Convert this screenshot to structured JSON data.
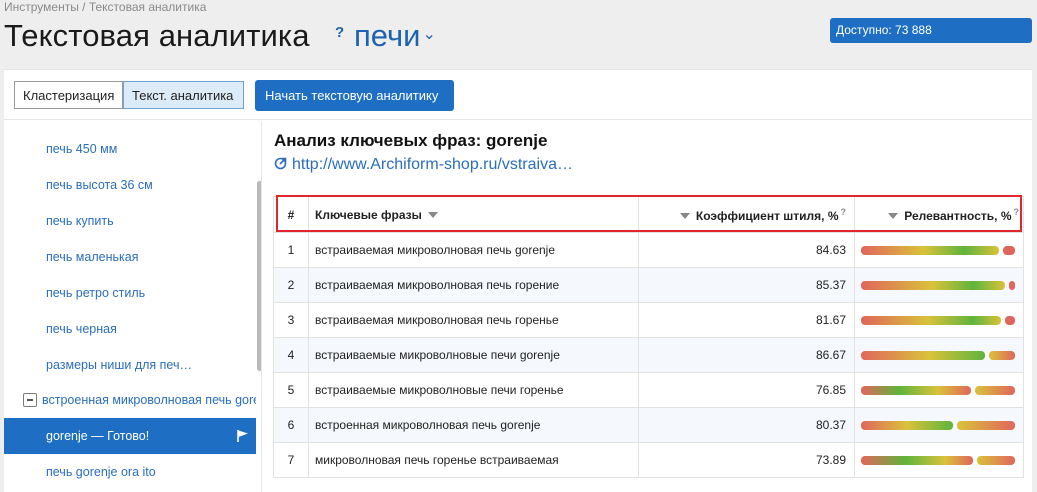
{
  "breadcrumb": "Инструменты / Текстовая аналитика",
  "header": {
    "title": "Текстовая аналитика",
    "help": "?",
    "project": "печи",
    "available": "Доступно: 73 888"
  },
  "toolbar": {
    "tab_clustering": "Кластеризация",
    "tab_text_analytics": "Текст. аналитика",
    "start_button": "Начать текстовую аналитику"
  },
  "sidebar": {
    "items": [
      "печь 450 мм",
      "печь высота 36 см",
      "печь купить",
      "печь маленькая",
      "печь ретро стиль",
      "печь черная",
      "размеры ниши для печ…"
    ],
    "group": "встроенная микроволновая печь gorenje",
    "active_item": "gorenje — Готово!",
    "after_item": "печь gorenje ora ito"
  },
  "analysis": {
    "title": "Анализ ключевых фраз: gorenje",
    "url": "http://www.Archiform-shop.ru/vstraiva…"
  },
  "table": {
    "headers": {
      "num": "#",
      "phrase": "Ключевые фразы",
      "coef": "Коэффициент штиля, %",
      "relevance": "Релевантность, %",
      "help": "?"
    },
    "rows": [
      {
        "num": "1",
        "phrase": "встраиваемая микроволновая печь gorenje",
        "coef": "84.63"
      },
      {
        "num": "2",
        "phrase": "встраиваемая микроволновая печь горение",
        "coef": "85.37"
      },
      {
        "num": "3",
        "phrase": "встраиваемая микроволновая печь горенье",
        "coef": "81.67"
      },
      {
        "num": "4",
        "phrase": "встраиваемые микроволновые печи gorenje",
        "coef": "86.67"
      },
      {
        "num": "5",
        "phrase": "встраиваемые микроволновые печи горенье",
        "coef": "76.85"
      },
      {
        "num": "6",
        "phrase": "встроенная микроволновая печь gorenje",
        "coef": "80.37"
      },
      {
        "num": "7",
        "phrase": "микроволновая печь горенье встраиваемая",
        "coef": "73.89"
      }
    ]
  },
  "colors": {
    "accent": "#1e6fc4",
    "highlight_outline": "#e0262c",
    "bar_gradient": [
      "#e0665c",
      "#d9c23a",
      "#5fb43c"
    ]
  }
}
